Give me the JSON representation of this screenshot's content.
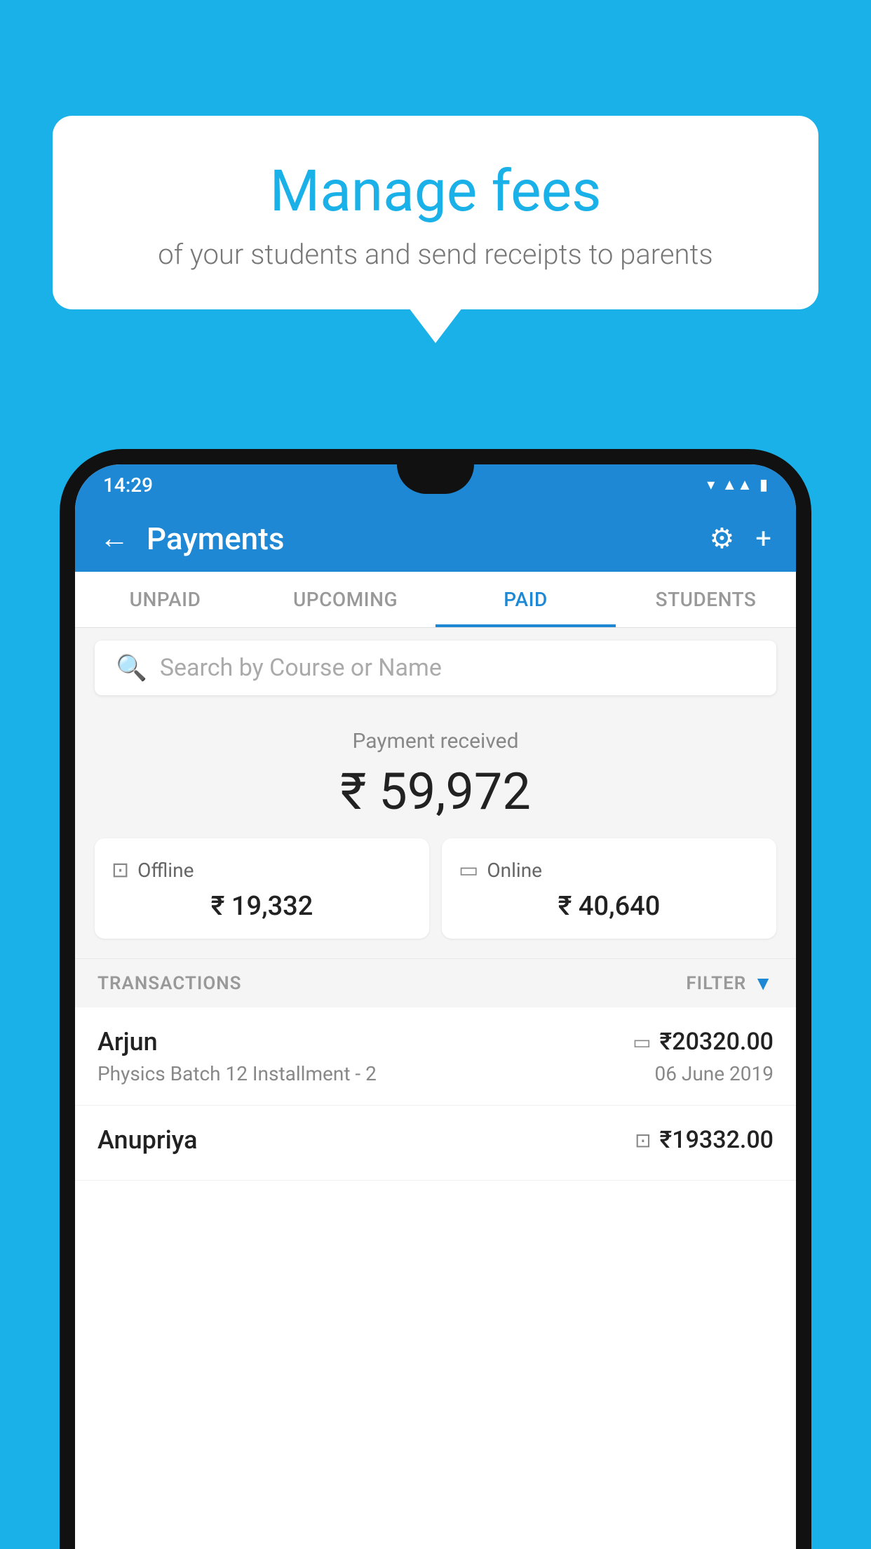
{
  "background_color": "#1ab0e8",
  "speech_bubble": {
    "title": "Manage fees",
    "subtitle": "of your students and send receipts to parents"
  },
  "status_bar": {
    "time": "14:29",
    "icons": [
      "wifi",
      "signal",
      "battery"
    ]
  },
  "app_header": {
    "title": "Payments",
    "back_label": "←",
    "settings_label": "⚙",
    "add_label": "+"
  },
  "tabs": [
    {
      "label": "UNPAID",
      "active": false
    },
    {
      "label": "UPCOMING",
      "active": false
    },
    {
      "label": "PAID",
      "active": true
    },
    {
      "label": "STUDENTS",
      "active": false
    }
  ],
  "search": {
    "placeholder": "Search by Course or Name"
  },
  "payment_summary": {
    "label": "Payment received",
    "amount": "₹ 59,972",
    "offline": {
      "icon": "💳",
      "label": "Offline",
      "amount": "₹ 19,332"
    },
    "online": {
      "icon": "💳",
      "label": "Online",
      "amount": "₹ 40,640"
    }
  },
  "transactions": {
    "header_label": "TRANSACTIONS",
    "filter_label": "FILTER",
    "items": [
      {
        "name": "Arjun",
        "course": "Physics Batch 12 Installment - 2",
        "amount": "₹20320.00",
        "date": "06 June 2019",
        "payment_type": "online"
      },
      {
        "name": "Anupriya",
        "course": "",
        "amount": "₹19332.00",
        "date": "",
        "payment_type": "offline"
      }
    ]
  }
}
